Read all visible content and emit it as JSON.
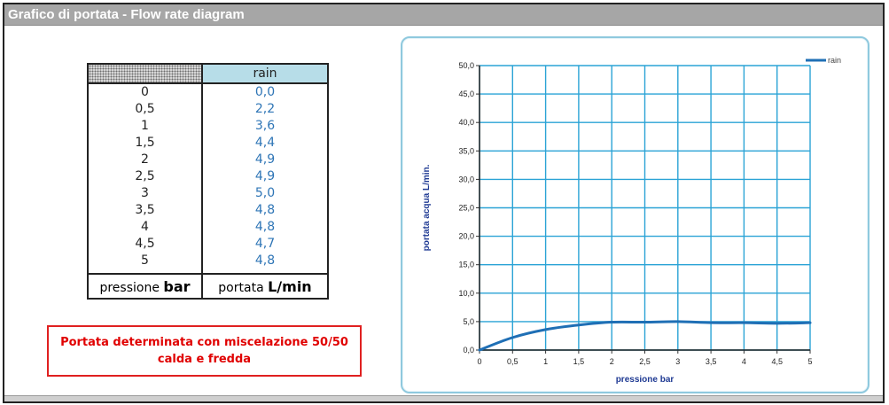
{
  "header": {
    "title": "Grafico di portata - Flow rate diagram"
  },
  "table": {
    "column_header": "rain",
    "rows": [
      {
        "p": "0",
        "v": "0,0"
      },
      {
        "p": "0,5",
        "v": "2,2"
      },
      {
        "p": "1",
        "v": "3,6"
      },
      {
        "p": "1,5",
        "v": "4,4"
      },
      {
        "p": "2",
        "v": "4,9"
      },
      {
        "p": "2,5",
        "v": "4,9"
      },
      {
        "p": "3",
        "v": "5,0"
      },
      {
        "p": "3,5",
        "v": "4,8"
      },
      {
        "p": "4",
        "v": "4,8"
      },
      {
        "p": "4,5",
        "v": "4,7"
      },
      {
        "p": "5",
        "v": "4,8"
      }
    ],
    "footer_left_text": "pressione",
    "footer_left_unit": "bar",
    "footer_right_text": "portata",
    "footer_right_unit": "L/min"
  },
  "note": {
    "line1": "Portata determinata con miscelazione 50/50",
    "line2": "calda e fredda"
  },
  "colors": {
    "series": "#1f6fb5",
    "grid": "#2aa3d6",
    "axis_label": "#1f3a93",
    "note_border": "#e02020",
    "value_text": "#2e75b6"
  },
  "chart_data": {
    "type": "line",
    "title": "",
    "xlabel": "pressione bar",
    "ylabel": "portata acqua L/min.",
    "xlim": [
      0,
      5
    ],
    "ylim": [
      0,
      50
    ],
    "x_ticks": [
      "0",
      "0,5",
      "1",
      "1,5",
      "2",
      "2,5",
      "3",
      "3,5",
      "4",
      "4,5",
      "5"
    ],
    "y_ticks": [
      "0,0",
      "5,0",
      "10,0",
      "15,0",
      "20,0",
      "25,0",
      "30,0",
      "35,0",
      "40,0",
      "45,0",
      "50,0"
    ],
    "grid": true,
    "legend_position": "top-right",
    "series": [
      {
        "name": "rain",
        "x": [
          0,
          0.5,
          1,
          1.5,
          2,
          2.5,
          3,
          3.5,
          4,
          4.5,
          5
        ],
        "values": [
          0.0,
          2.2,
          3.6,
          4.4,
          4.9,
          4.9,
          5.0,
          4.8,
          4.8,
          4.7,
          4.8
        ]
      }
    ]
  }
}
